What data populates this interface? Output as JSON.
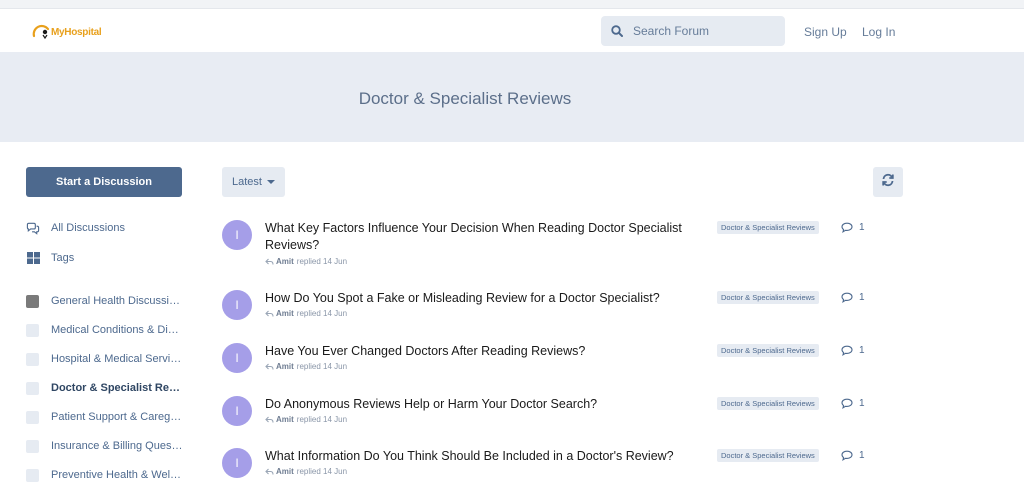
{
  "header": {
    "logo_text": "MyHospital",
    "search_placeholder": "Search Forum",
    "signup": "Sign Up",
    "login": "Log In"
  },
  "hero": {
    "title": "Doctor & Specialist Reviews"
  },
  "sidebar": {
    "start_button": "Start a Discussion",
    "nav": [
      {
        "label": "All Discussions",
        "icon": "comments-icon"
      },
      {
        "label": "Tags",
        "icon": "tags-grid-icon"
      }
    ],
    "categories": [
      {
        "label": "General Health Discussions",
        "color": "#7a7a7a"
      },
      {
        "label": "Medical Conditions & Diseases",
        "color": "#e6ebf2"
      },
      {
        "label": "Hospital & Medical Services",
        "color": "#e6ebf2"
      },
      {
        "label": "Doctor & Specialist Reviews",
        "color": "#e6ebf2",
        "active": true
      },
      {
        "label": "Patient Support & Caregivers",
        "color": "#e6ebf2"
      },
      {
        "label": "Insurance & Billing Questions",
        "color": "#e6ebf2"
      },
      {
        "label": "Preventive Health & Wellness",
        "color": "#e6ebf2"
      }
    ]
  },
  "toolbar": {
    "sort_label": "Latest"
  },
  "discussions": [
    {
      "avatar": "I",
      "title": "What Key Factors Influence Your Decision When Reading Doctor Specialist Reviews?",
      "user": "Amit",
      "action": "replied",
      "date": "14 Jun",
      "tag": "Doctor & Specialist Reviews",
      "replies": "1"
    },
    {
      "avatar": "I",
      "title": "How Do You Spot a Fake or Misleading Review for a Doctor Specialist?",
      "user": "Amit",
      "action": "replied",
      "date": "14 Jun",
      "tag": "Doctor & Specialist Reviews",
      "replies": "1"
    },
    {
      "avatar": "I",
      "title": "Have You Ever Changed Doctors After Reading Reviews?",
      "user": "Amit",
      "action": "replied",
      "date": "14 Jun",
      "tag": "Doctor & Specialist Reviews",
      "replies": "1"
    },
    {
      "avatar": "I",
      "title": "Do Anonymous Reviews Help or Harm Your Doctor Search?",
      "user": "Amit",
      "action": "replied",
      "date": "14 Jun",
      "tag": "Doctor & Specialist Reviews",
      "replies": "1"
    },
    {
      "avatar": "I",
      "title": "What Information Do You Think Should Be Included in a Doctor's Review?",
      "user": "Amit",
      "action": "replied",
      "date": "14 Jun",
      "tag": "Doctor & Specialist Reviews",
      "replies": "1"
    }
  ],
  "colors": {
    "accent": "#4d698e",
    "hero_bg": "#e8ecf3",
    "avatar": "#a59ee8",
    "chip_bg": "#e6ebf2",
    "logo": "#e8a01c"
  }
}
